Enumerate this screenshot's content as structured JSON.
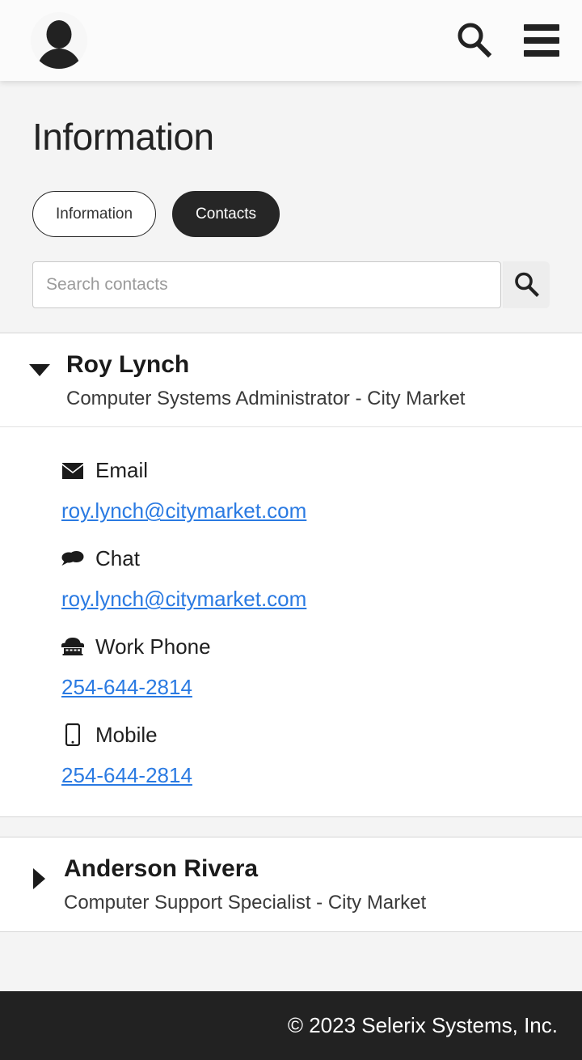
{
  "appbar": {
    "avatar_name": "user-avatar",
    "search_icon": "search-icon",
    "menu_icon": "hamburger-menu-icon"
  },
  "page": {
    "title": "Information"
  },
  "tabs": [
    {
      "label": "Information",
      "active": false
    },
    {
      "label": "Contacts",
      "active": true
    }
  ],
  "search": {
    "placeholder": "Search contacts",
    "value": "",
    "button_icon": "search-icon"
  },
  "contacts": [
    {
      "name": "Roy Lynch",
      "role": "Computer Systems Administrator - City Market",
      "expanded": true,
      "caret": "caret-down-icon",
      "fields": [
        {
          "icon": "envelope-icon",
          "glyph": "✉",
          "label": "Email",
          "value": "roy.lynch@citymarket.com"
        },
        {
          "icon": "chat-bubble-icon",
          "glyph": "🗩",
          "label": "Chat",
          "value": "roy.lynch@citymarket.com"
        },
        {
          "icon": "telephone-icon",
          "glyph": "☎",
          "label": "Work Phone",
          "value": "254-644-2814"
        },
        {
          "icon": "mobile-phone-icon",
          "glyph": "📱",
          "label": "Mobile",
          "value": "254-644-2814"
        }
      ]
    },
    {
      "name": "Anderson Rivera",
      "role": "Computer Support Specialist - City Market",
      "expanded": false,
      "caret": "caret-right-icon",
      "fields": []
    }
  ],
  "footer": {
    "copyright": "© 2023 Selerix Systems, Inc."
  },
  "colors": {
    "page_background": "#f4f4f4",
    "card_background": "#ffffff",
    "appbar_background": "#fbfbfb",
    "accent_dark": "#262626",
    "link_blue": "#2a7ae2",
    "footer_background": "#222222",
    "placeholder_gray": "#9b9b9b"
  }
}
